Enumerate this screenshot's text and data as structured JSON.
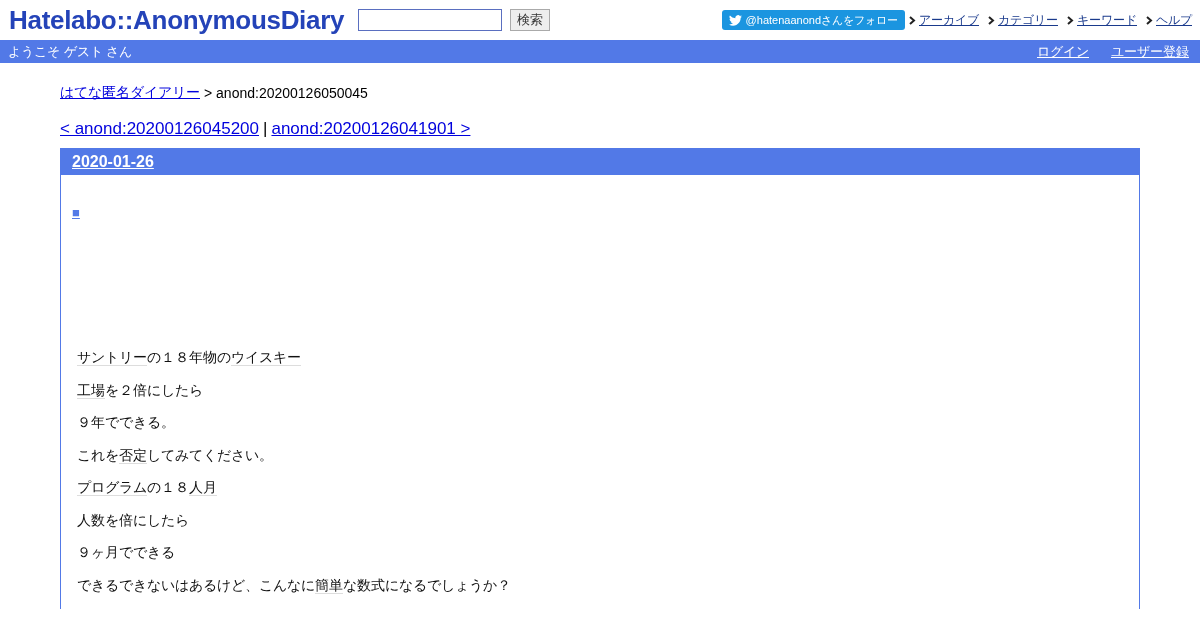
{
  "header": {
    "logo": "Hatelabo::AnonymousDiary",
    "search": {
      "button": "検索"
    },
    "follow_button": "@hatenaanondさんをフォロー",
    "nav": [
      "アーカイブ",
      "カテゴリー",
      "キーワード",
      "ヘルプ"
    ]
  },
  "user_bar": {
    "greeting": "ようこそ ゲスト さん",
    "links": [
      "ログイン",
      "ユーザー登録"
    ]
  },
  "breadcrumb": {
    "link": "はてな匿名ダイアリー",
    "current": "> anond:20200126050045"
  },
  "pager": {
    "prev": "< anond:20200126045200",
    "separator": "|",
    "next": "anond:20200126041901 >"
  },
  "section": {
    "date": "2020-01-26",
    "anchor": "■",
    "paragraphs": [
      [
        {
          "kind": "keyword",
          "text": "サントリー"
        },
        {
          "kind": "text",
          "text": "の１８年物の"
        },
        {
          "kind": "keyword",
          "text": "ウイスキー"
        }
      ],
      [
        {
          "kind": "keyword",
          "text": "工場"
        },
        {
          "kind": "text",
          "text": "を２倍にしたら"
        }
      ],
      [
        {
          "kind": "text",
          "text": "９年でできる。"
        }
      ],
      [
        {
          "kind": "text",
          "text": "これを"
        },
        {
          "kind": "keyword",
          "text": "否定"
        },
        {
          "kind": "text",
          "text": "してみてください。"
        }
      ],
      [
        {
          "kind": "keyword",
          "text": "プログラム"
        },
        {
          "kind": "text",
          "text": "の１８"
        },
        {
          "kind": "keyword",
          "text": "人月"
        }
      ],
      [
        {
          "kind": "text",
          "text": "人数を倍にしたら"
        }
      ],
      [
        {
          "kind": "text",
          "text": "９ヶ月でできる"
        }
      ],
      [
        {
          "kind": "text",
          "text": "できるできないはあるけど、こんなに"
        },
        {
          "kind": "keyword",
          "text": "簡単"
        },
        {
          "kind": "text",
          "text": "な数式になるでしょうか？"
        }
      ]
    ]
  }
}
